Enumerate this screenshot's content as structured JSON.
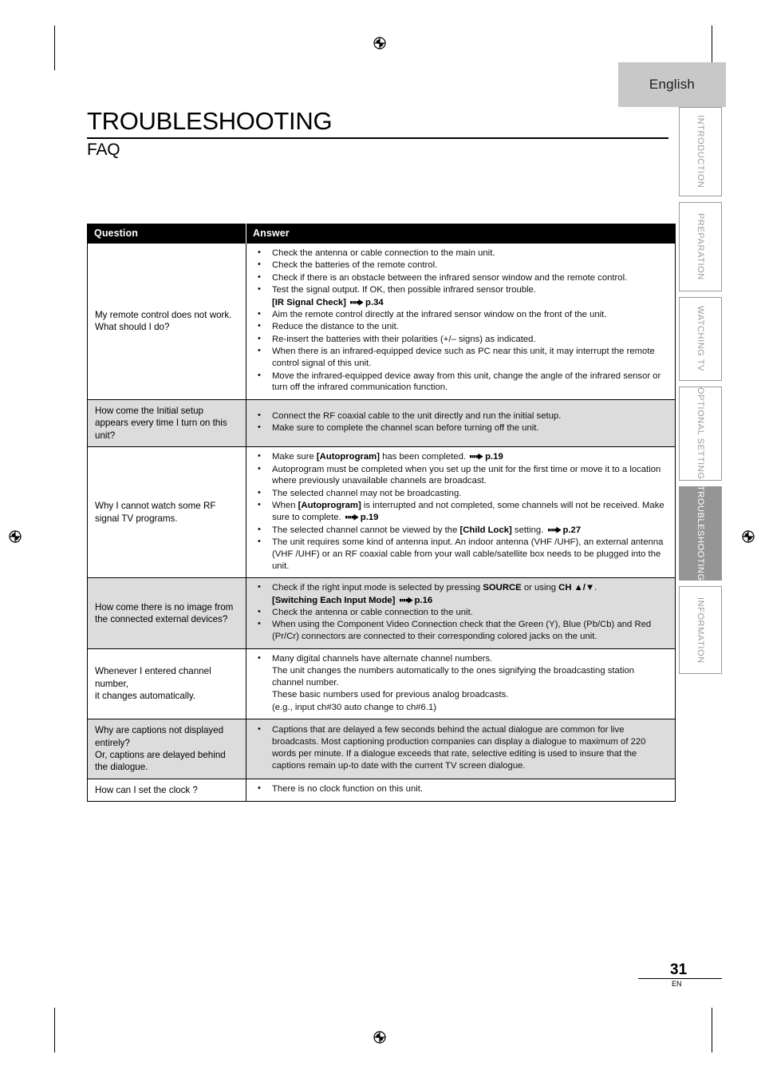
{
  "page": {
    "language_badge": "English",
    "title": "TROUBLESHOOTING",
    "subtitle": "FAQ",
    "page_number": "31",
    "page_language_code": "EN"
  },
  "side_tabs": [
    {
      "label": "INTRODUCTION",
      "active": false
    },
    {
      "label": "PREPARATION",
      "active": false
    },
    {
      "label": "WATCHING TV",
      "active": false
    },
    {
      "label": "OPTIONAL SETTING",
      "active": false
    },
    {
      "label": "TROUBLESHOOTING",
      "active": true
    },
    {
      "label": "INFORMATION",
      "active": false
    }
  ],
  "table": {
    "headers": {
      "question": "Question",
      "answer": "Answer"
    },
    "rows": [
      {
        "shaded": false,
        "question": "My remote control does not work.\nWhat should I do?",
        "answers": [
          "Check the antenna or cable connection to the main unit.",
          "Check the batteries of the remote control.",
          "Check if there is an obstacle between the infrared sensor window and the remote control.",
          "Test the signal output. If OK, then possible infrared sensor trouble.",
          "[IR Signal Check] ➡ p.34",
          "Aim the remote control directly at the infrared sensor window on the front of the unit.",
          "Reduce the distance to the unit.",
          "Re-insert the batteries with their polarities (+/– signs) as indicated.",
          "When there is an infrared-equipped device such as PC near this unit, it may interrupt the remote control signal of this unit.",
          "Move the infrared-equipped device away from this unit, change the angle of the infrared sensor or turn off the infrared communication function."
        ]
      },
      {
        "shaded": true,
        "question": "How come the Initial setup appears every time I turn on this unit?",
        "answers": [
          "Connect the RF coaxial cable to the unit directly and run the initial setup.",
          "Make sure to complete the channel scan before turning off the unit."
        ]
      },
      {
        "shaded": false,
        "question": "Why I cannot watch some RF signal TV programs.",
        "answers": [
          "Make sure [Autoprogram] has been completed. ➡ p.19",
          "Autoprogram must be completed when you set up the unit for the first time or move it to a location where previously unavailable channels are broadcast.",
          "The selected channel may not be broadcasting.",
          "When [Autoprogram] is interrupted and not completed, some channels will not be received. Make sure to complete. ➡ p.19",
          "The selected channel cannot be viewed by the [Child Lock] setting. ➡ p.27",
          "The unit requires some kind of antenna input. An indoor antenna (VHF /UHF), an external antenna (VHF /UHF) or an RF coaxial cable from your wall cable/satellite box needs to be plugged into the unit."
        ]
      },
      {
        "shaded": true,
        "question": "How come there is no image from the connected external devices?",
        "answers": [
          "Check if the right input mode is selected by pressing SOURCE or using CH ▲/▼.",
          "[Switching Each Input Mode] ➡ p.16",
          "Check the antenna or cable connection to the unit.",
          "When using the Component Video Connection check that the Green (Y), Blue (Pb/Cb) and Red (Pr/Cr) connectors are connected to their corresponding colored jacks on the unit."
        ]
      },
      {
        "shaded": false,
        "question": "Whenever I entered channel number,\nit changes automatically.",
        "answers": [
          "Many digital channels have alternate channel numbers.",
          "The unit changes the numbers automatically to the ones signifying the broadcasting station channel number.",
          "These basic numbers used for previous analog broadcasts.",
          "(e.g., input ch#30 auto change to ch#6.1)"
        ]
      },
      {
        "shaded": true,
        "question": "Why are captions not displayed entirely?\nOr, captions are delayed behind the dialogue.",
        "answers": [
          "Captions that are delayed a few seconds behind the actual dialogue are common for live broadcasts. Most captioning production companies can display a dialogue to maximum of 220 words per minute. If a dialogue exceeds that rate, selective editing is used to insure that the captions remain up-to date with the current TV screen dialogue."
        ]
      },
      {
        "shaded": false,
        "question": "How can I set the clock ?",
        "answers": [
          "There is no clock function on this unit."
        ]
      }
    ]
  }
}
